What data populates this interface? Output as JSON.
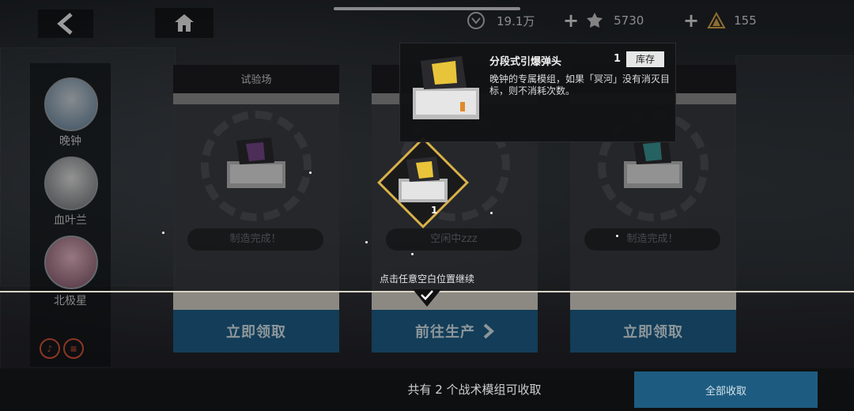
{
  "currencies": {
    "credits": "19.1万",
    "materials": "5730",
    "energy": "155"
  },
  "roster": {
    "items": [
      {
        "name": "晚钟"
      },
      {
        "name": "血叶兰"
      },
      {
        "name": "北极星"
      }
    ]
  },
  "cards": [
    {
      "title": "试验场",
      "status": "制造完成！",
      "button": "立即领取"
    },
    {
      "title": "",
      "status": "空闲中zzz",
      "button": "前往生产"
    },
    {
      "title": "",
      "status": "制造完成！",
      "button": "立即领取"
    }
  ],
  "tooltip": {
    "name": "分段式引爆弹头",
    "count": "1",
    "badge": "库存",
    "description": "晚钟的专属模组，如果「冥河」没有消灭目标，则不消耗次数。"
  },
  "selected_module": {
    "count": "1"
  },
  "hint": "点击任意空白位置继续",
  "bottom": {
    "summary": "共有 2 个战术模组可收取",
    "collect_all": "全部收取"
  },
  "colors": {
    "accent_blue": "#1e5f87",
    "gold": "#d9b04a",
    "red_icon": "#d9533a"
  },
  "icons": [
    "back-arrow-icon",
    "home-icon",
    "credits-icon",
    "materials-icon",
    "energy-icon",
    "plus-icon",
    "check-icon",
    "chevron-right-icon",
    "module-case-icon"
  ]
}
